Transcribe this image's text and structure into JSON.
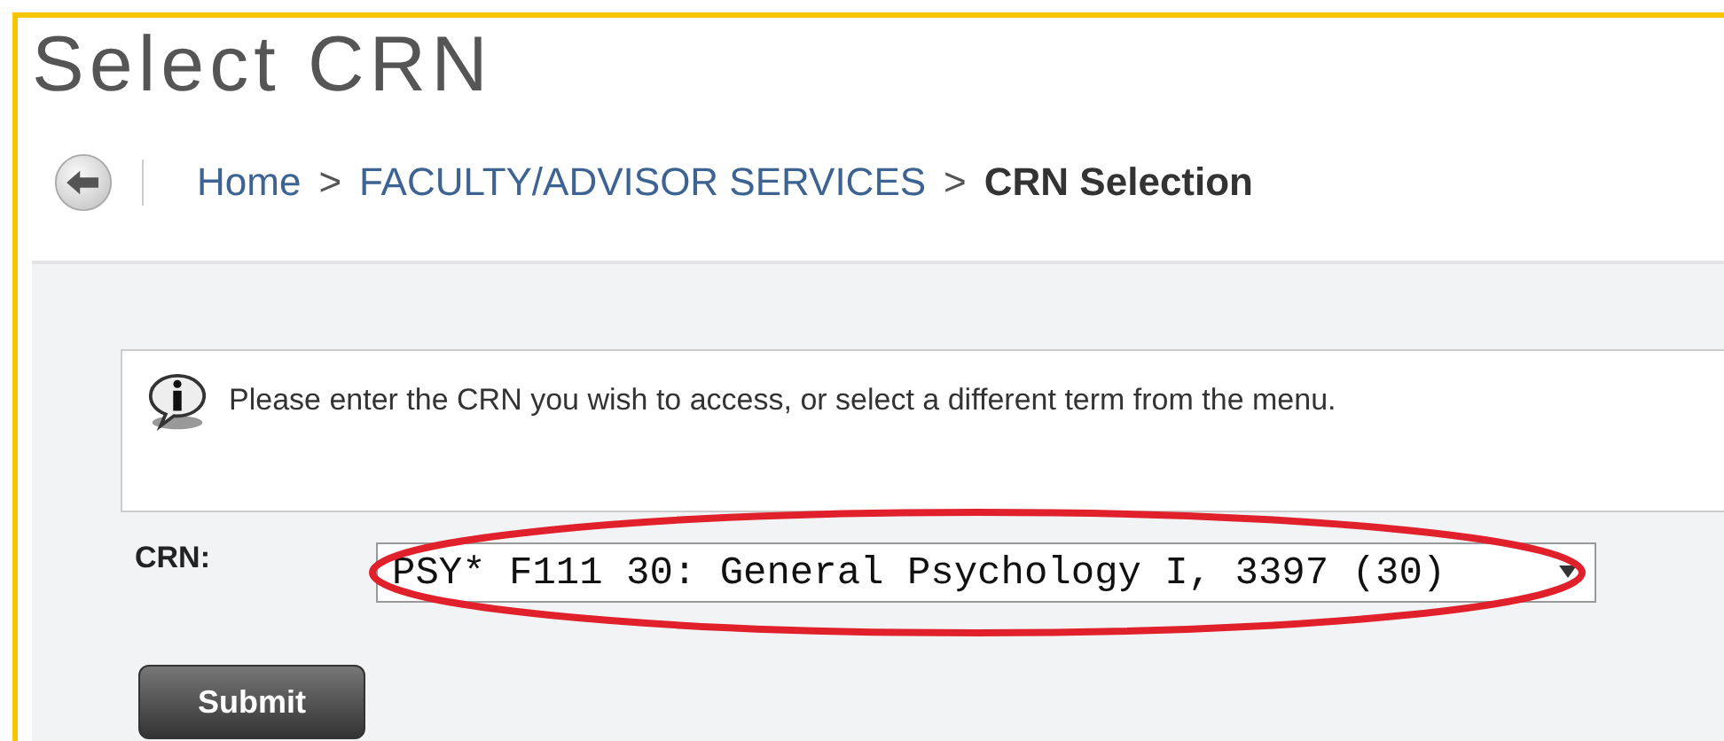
{
  "title": "Select CRN",
  "breadcrumb": [
    {
      "label": "Home",
      "current": false
    },
    {
      "label": "FACULTY/ADVISOR SERVICES",
      "current": false
    },
    {
      "label": "CRN Selection",
      "current": true
    }
  ],
  "breadcrumb_separator": ">",
  "info_message": "Please enter the CRN you wish to access, or select a different term from the menu.",
  "crn_field": {
    "label": "CRN:",
    "value": "PSY* F111 30: General Psychology I, 3397 (30)",
    "highlighted": true
  },
  "submit_button": "Submit"
}
